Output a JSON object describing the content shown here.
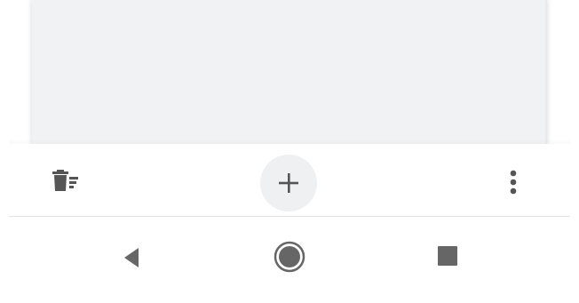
{
  "content": {
    "card_color": "#f1f2f4"
  },
  "toolbar": {
    "delete_icon": "trash-list-icon",
    "add_icon": "plus-icon",
    "more_icon": "vertical-dots-icon",
    "icon_color": "#555555",
    "add_button_bg": "#eef0f2"
  },
  "navbar": {
    "back_icon": "triangle-back-icon",
    "home_icon": "circle-home-icon",
    "recents_icon": "square-recents-icon",
    "icon_color": "#666666"
  }
}
